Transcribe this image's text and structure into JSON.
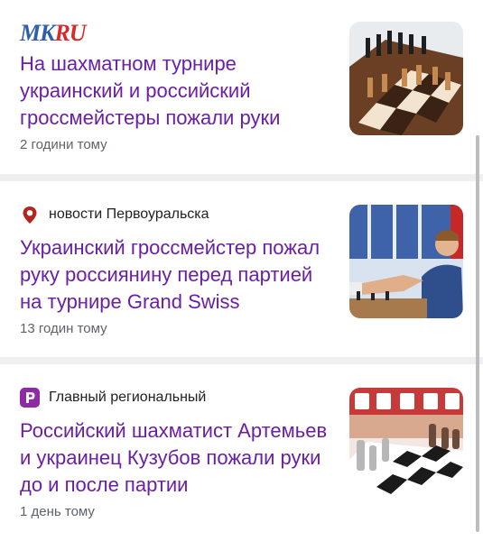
{
  "articles": [
    {
      "source": "MKRU",
      "source_logo": {
        "part1": "MK",
        "part2": "RU",
        "color1": "#2f5fa8",
        "color2": "#d62b2b"
      },
      "title": "На шахматном турнире украинский и российский гроссмейстеры пожали руки",
      "time": "2 години тому",
      "image": "chessboard-photo"
    },
    {
      "source": "новости Первоуральска",
      "source_icon": "location-pin-icon",
      "title": "Украинский гроссмейстер пожал руку россиянину перед партией на турнире Grand Swiss",
      "time": "13 годин тому",
      "image": "handshake-photo"
    },
    {
      "source": "Главный региональный",
      "source_icon": "p-logo-icon",
      "title": "Российский шахматист Артемьев и украинец Кузубов пожали руки до и после партии",
      "time": "1 день тому",
      "image": "chess-pieces-photo"
    }
  ],
  "colors": {
    "title": "#6a1fa4",
    "meta": "#5f6368",
    "separator": "#eeeff1"
  }
}
